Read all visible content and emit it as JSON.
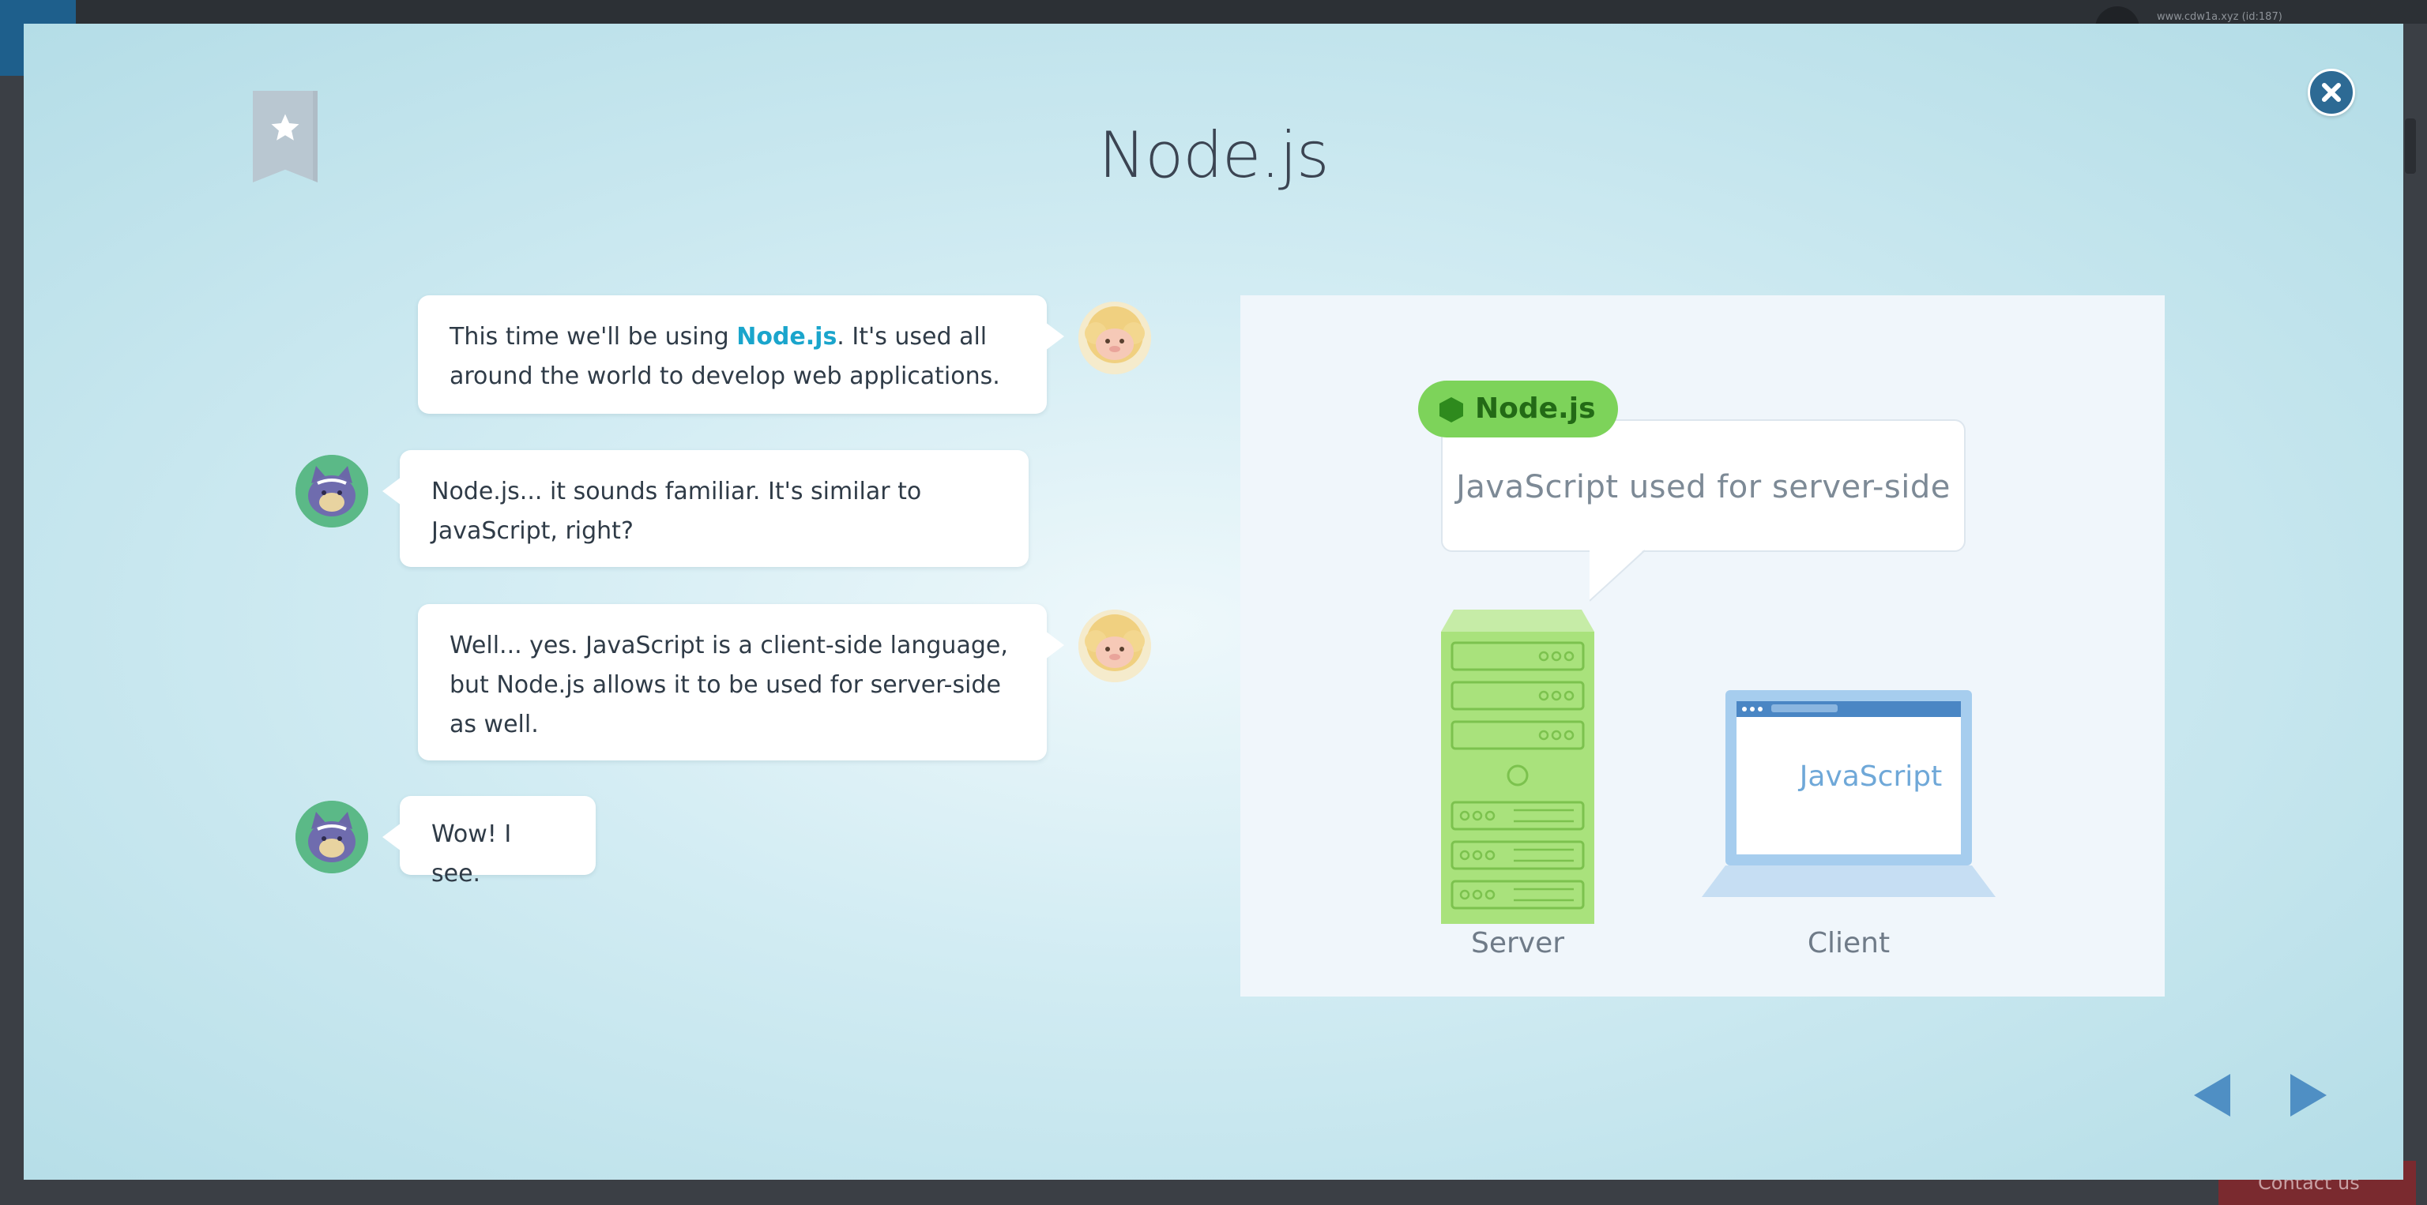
{
  "background": {
    "url_text": "www.cdw1a.xyz (id:187)",
    "contact_label": "Contact us"
  },
  "modal": {
    "title": "Node.js"
  },
  "chat": [
    {
      "speaker": "sheep",
      "side": "right",
      "pre": "This time we'll be using ",
      "highlight": "Node.js",
      "post": ". It's used all around the world to develop web applications."
    },
    {
      "speaker": "cat",
      "side": "left",
      "text": "Node.js... it sounds familiar. It's similar to JavaScript, right?"
    },
    {
      "speaker": "sheep",
      "side": "right",
      "text": "Well... yes. JavaScript is a client-side language, but Node.js allows it to be used for server-side as well."
    },
    {
      "speaker": "cat",
      "side": "left",
      "text": "Wow! I see."
    }
  ],
  "diagram": {
    "badge": "Node.js",
    "speech": "JavaScript used for server-side",
    "laptop_text": "JavaScript",
    "server_label": "Server",
    "client_label": "Client"
  },
  "colors": {
    "accent": "#1aa5cc",
    "node_green": "#7dd35a",
    "close_blue": "#2d6a94",
    "nav_blue": "#4f8fc4"
  },
  "icons": {
    "bookmark": "star-bookmark-icon",
    "close": "close-icon",
    "prev": "triangle-left-icon",
    "next": "triangle-right-icon"
  }
}
